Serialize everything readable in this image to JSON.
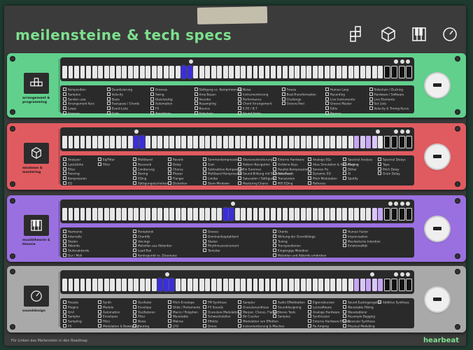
{
  "header": {
    "title": "meilensteine & tech specs",
    "icons": [
      "blocks-icon",
      "cube-icon",
      "piano-icon",
      "gauge-icon"
    ]
  },
  "colors": {
    "green": "#61d08d",
    "red": "#e05b60",
    "purple": "#9a70e0",
    "gray": "#a9a9a9",
    "select": "#3a2ed6",
    "accent": "#7de08e"
  },
  "panels": [
    {
      "id": "arrangement",
      "label": "arrangement & programming",
      "icon": "blocks-icon",
      "columns": [
        [
          "Komposition",
          "Samplen",
          "Senden usw.",
          "Arrangement Kurs",
          "Loops",
          "Grooves"
        ],
        [
          "Quantisierung",
          "Velocity",
          "Skala",
          "Transpose / Chords",
          "Event-Liste",
          "Grids"
        ],
        [
          "Grooves",
          "Swing",
          "Gleichzeitig",
          "Automation",
          "FX",
          "Transitions"
        ],
        [
          "Sättigung vs. Komprimierung",
          "Amp Bauen",
          "Vocoder",
          "Resampling",
          "Bounce",
          "Sidechain"
        ],
        [
          "Noise",
          "Instrumentierung",
          "Performance",
          "Chord Arrangement",
          "E.P.E / B.T",
          "Sound Fades"
        ],
        [
          "Freeze",
          "Beat-Transformation",
          "Challenge",
          "Groove-Pool"
        ],
        [
          "Human Loop",
          "Recording",
          "Live Instrumente",
          "Groove Master",
          "Edits",
          "Bounce"
        ],
        [
          "Sidechain / Ducking",
          "Hardware / Software",
          "Live Elemente",
          "Set Lists",
          "Velocity & Timing Kurve"
        ]
      ]
    },
    {
      "id": "mixdown",
      "label": "mixdown & mastering",
      "icon": "cube-icon",
      "columns": [
        [
          "Analyzer",
          "Lautstärke",
          "Filter",
          "Panning",
          "Kompression",
          "EQ"
        ],
        [
          "Eq/Filter",
          "Filter"
        ],
        [
          "Multiband",
          "Bussverb",
          "Limitierung",
          "Boxing",
          "EQing",
          "Sättigungstechniken"
        ],
        [
          "Reverb",
          "Delay",
          "Chorus",
          "Phaser",
          "Flanger",
          "Distortion"
        ],
        [
          "Summenkompression",
          "Gain",
          "Subtraktive Komposition",
          "Multiband Kompression",
          "Limiter",
          "Stem-Mixdown"
        ],
        [
          "Stereoverbreiterung",
          "Pattern Navigation",
          "Ein Summen",
          "Sound-Bildung mit Summen-Busch",
          "Saturation / Sättigung",
          "Mastering Chains"
        ],
        [
          "Externe Hardware",
          "Goldene Keys",
          "Parallel-Kompression",
          "Sidechain",
          "Transienten",
          "M/S EQing"
        ],
        [
          "Analoge EQs",
          "Alias Simulation & Anti-Aliasing",
          "Sonnox Fix",
          "Dynamic EQ",
          "Pitch Modulation",
          "Referenz"
        ],
        [
          "Spectral Analyse",
          "Plugins",
          "Dither",
          "AI",
          "Spotify"
        ],
        [
          "Spectral Delays",
          "Tape",
          "Pitch Delay",
          "Grain Delay"
        ]
      ]
    },
    {
      "id": "musiktheorie",
      "label": "musiktheorie & theorie",
      "icon": "piano-icon",
      "columns": [
        [
          "Harmonie",
          "Intervalle",
          "Skalen",
          "Akkorde",
          "Stufenakkorde",
          "Dur / Moll"
        ],
        [
          "Pentatonik",
          "Chordify",
          "Voicings",
          "Melodien aus Akkorden",
          "Lead-Tool",
          "Kontrapunkt vs. Dissonanz"
        ],
        [
          "Groove",
          "Dominantseptakkord",
          "Skalen",
          "Rhythmusinstrument",
          "Tonleiter"
        ],
        [
          "Chords",
          "Wirkung der Grundklänge",
          "Tuning",
          "Transpositionen",
          "Eingängige Melodien",
          "Melodien und Akkorde umdrehen"
        ],
        [
          "Human Factor",
          "Improvisation",
          "Musikalische Intention",
          "Emotionalität"
        ]
      ]
    },
    {
      "id": "sounddesign",
      "label": "sounddesign",
      "icon": "gauge-icon",
      "columns": [
        [
          "Presets",
          "Plugins",
          "Grid",
          "Sampler",
          "Sampling",
          "FX"
        ],
        [
          "Synth",
          "Module",
          "Automation",
          "Envelopes",
          "Filter",
          "Modulation & Bewegung"
        ],
        [
          "Oscillator",
          "Envelope",
          "Oszillatoren",
          "Filter",
          "Noise",
          "Routing"
        ],
        [
          "Pitch Envelope",
          "Glide / Portamento",
          "Macro / Polyphon",
          "Wavetable",
          "Makros",
          "LFO"
        ],
        [
          "FM Synthese",
          "FX Sounds",
          "Granulare Modulation",
          "Schwachstellen",
          "Effekte",
          "Drone"
        ],
        [
          "Sampler",
          "Granularsynthese",
          "Warper, Chorus, Flanger",
          "Bit Crusher",
          "Modulation von Effekten",
          "Instrumentierung & Mischen"
        ],
        [
          "Audio Effektketten",
          "Sounddesigning",
          "Stereo Tools",
          "Samples"
        ],
        [
          "Eigenrekursion",
          "Lernsoftware",
          "Analoge Hardware",
          "Synthesizer",
          "Externe Hardware Effekte",
          "Re-Amping"
        ],
        [
          "Sound Eastingsiegelse",
          "Wavetable-Fitting",
          "Wavetablerer",
          "Resample Bagging",
          "Granular Synthese",
          "Physical Modelling"
        ],
        [
          "Additive Synthese"
        ]
      ]
    }
  ],
  "footer": {
    "text": "Für Linken das Meilenstein in den Roadmap",
    "brand": "hearbeat"
  }
}
